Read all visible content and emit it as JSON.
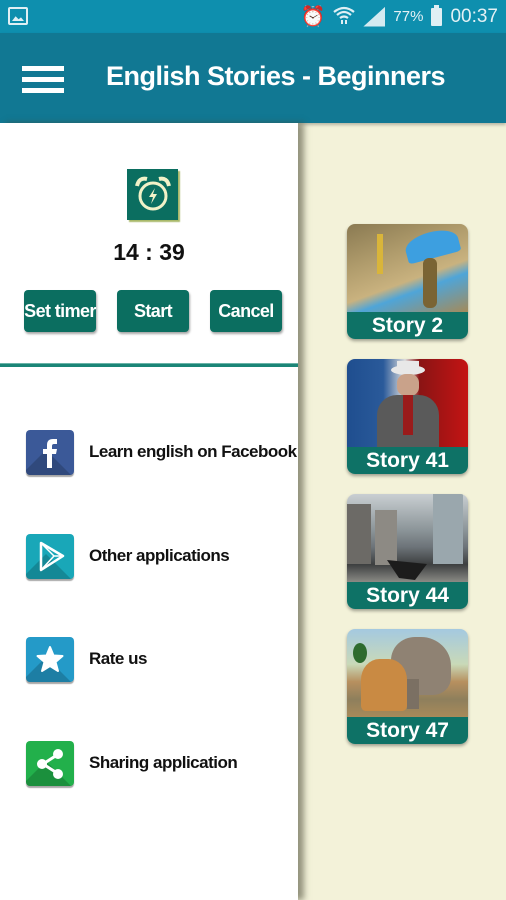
{
  "status_bar": {
    "battery": "77%",
    "time": "00:37",
    "icons": [
      "gallery-icon",
      "alarm-icon",
      "wifi-icon",
      "signal-icon",
      "battery-icon"
    ]
  },
  "app_bar": {
    "menu_icon": "hamburger-icon",
    "title": "English Stories - Beginners"
  },
  "drawer": {
    "timer": {
      "icon": "alarm-clock-icon",
      "value": "14 : 39",
      "buttons": {
        "set_timer": "Set timer",
        "start": "Start",
        "cancel": "Cancel"
      }
    },
    "menu": [
      {
        "icon": "facebook-icon",
        "label": "Learn english on Facebook"
      },
      {
        "icon": "play-store-icon",
        "label": "Other applications"
      },
      {
        "icon": "star-icon",
        "label": "Rate us"
      },
      {
        "icon": "share-icon",
        "label": "Sharing application"
      }
    ]
  },
  "stories": [
    {
      "label": "Story 2"
    },
    {
      "label": "Story 41"
    },
    {
      "label": "Story 44"
    },
    {
      "label": "Story 47"
    }
  ],
  "colors": {
    "status_bar": "#0e8fae",
    "app_bar": "#117893",
    "accent": "#0b6e60",
    "background": "#f3f2d9"
  }
}
